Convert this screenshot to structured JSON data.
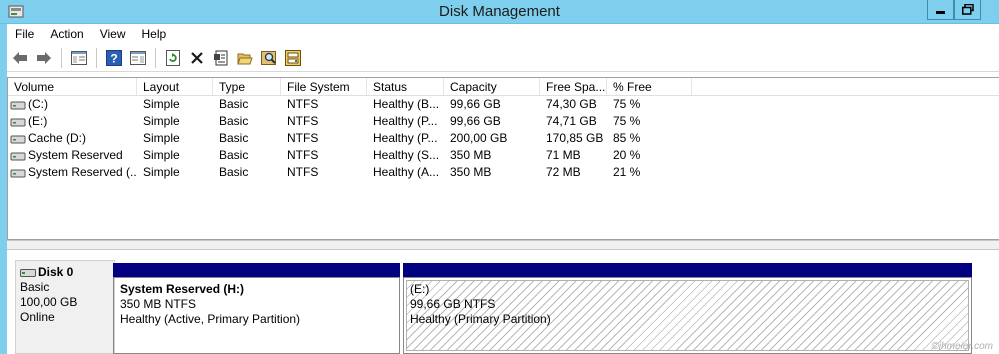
{
  "window": {
    "title": "Disk Management"
  },
  "menu": [
    "File",
    "Action",
    "View",
    "Help"
  ],
  "toolbar": {
    "icons": [
      "back-arrow-icon",
      "forward-arrow-icon",
      "console-tree-icon",
      "help-icon",
      "action-pane-icon",
      "refresh-icon",
      "delete-icon",
      "properties-icon",
      "open-icon",
      "explore-icon",
      "disk-help-icon"
    ]
  },
  "volume_list": {
    "headers": [
      "Volume",
      "Layout",
      "Type",
      "File System",
      "Status",
      "Capacity",
      "Free Spa...",
      "% Free"
    ],
    "rows": [
      [
        "(C:)",
        "Simple",
        "Basic",
        "NTFS",
        "Healthy (B...",
        "99,66 GB",
        "74,30 GB",
        "75 %"
      ],
      [
        "(E:)",
        "Simple",
        "Basic",
        "NTFS",
        "Healthy (P...",
        "99,66 GB",
        "74,71 GB",
        "75 %"
      ],
      [
        "Cache (D:)",
        "Simple",
        "Basic",
        "NTFS",
        "Healthy (P...",
        "200,00 GB",
        "170,85 GB",
        "85 %"
      ],
      [
        "System Reserved",
        "Simple",
        "Basic",
        "NTFS",
        "Healthy (S...",
        "350 MB",
        "71 MB",
        "20 %"
      ],
      [
        "System Reserved (...",
        "Simple",
        "Basic",
        "NTFS",
        "Healthy (A...",
        "350 MB",
        "72 MB",
        "21 %"
      ]
    ]
  },
  "disk": {
    "name": "Disk 0",
    "type": "Basic",
    "size": "100,00 GB",
    "status": "Online",
    "partitions": [
      {
        "name": "System Reserved  (H:)",
        "size": "350 MB NTFS",
        "status": "Healthy (Active, Primary Partition)"
      },
      {
        "name": "(E:)",
        "size": "99,66 GB NTFS",
        "status": "Healthy (Primary Partition)"
      }
    ]
  },
  "watermark": "©jhmeier.com"
}
